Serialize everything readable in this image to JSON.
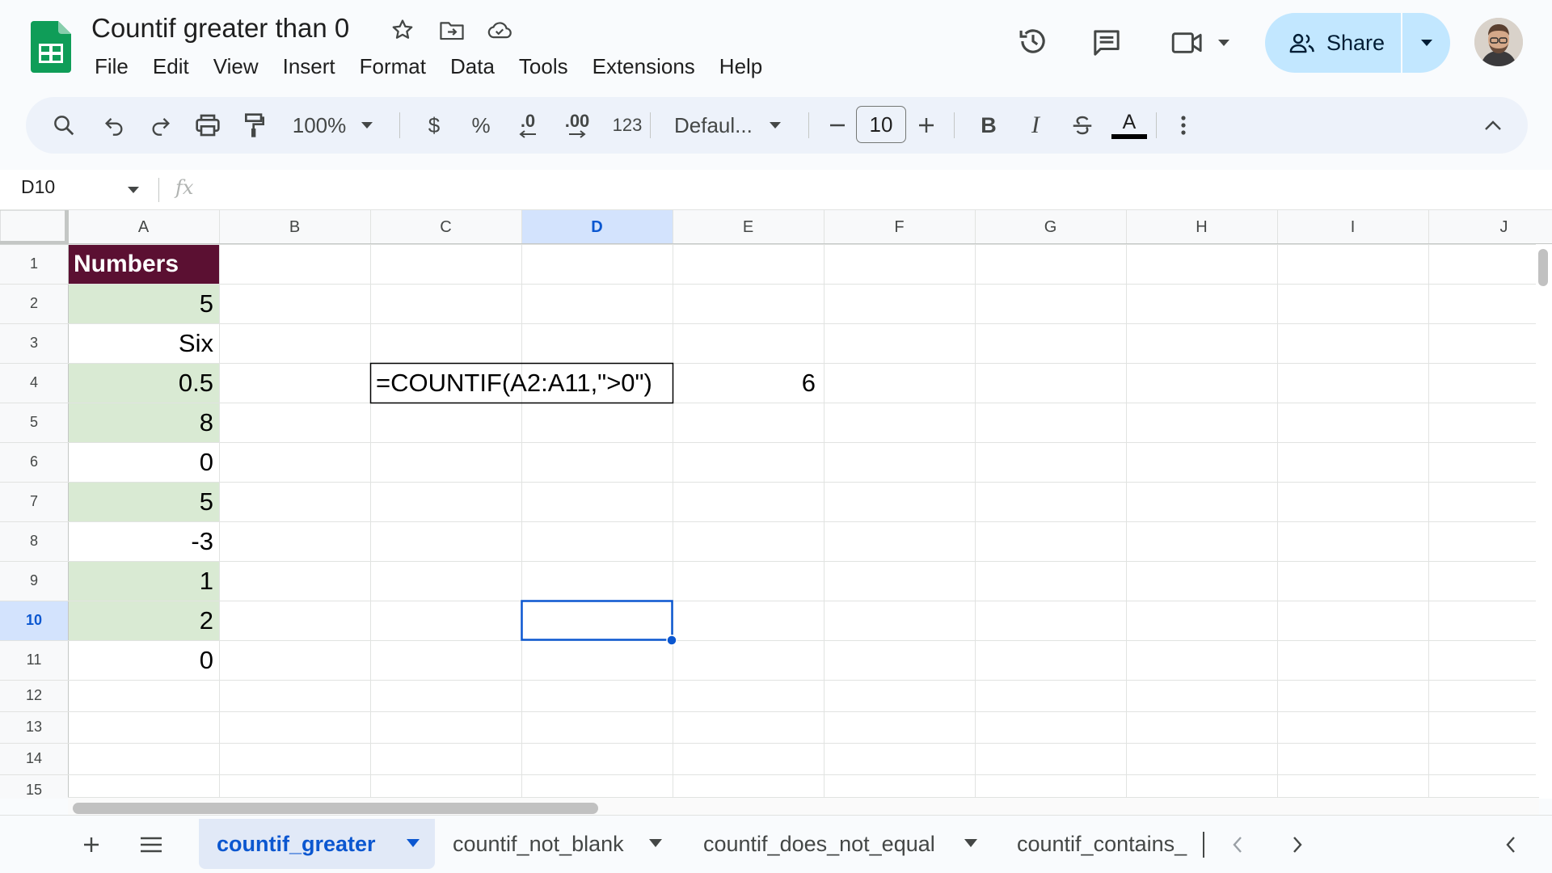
{
  "app": {
    "title": "Countif greater than 0",
    "menu": [
      "File",
      "Edit",
      "View",
      "Insert",
      "Format",
      "Data",
      "Tools",
      "Extensions",
      "Help"
    ],
    "share_label": "Share",
    "logo_icon": "google-sheets-logo",
    "colors": {
      "accent": "#0b57d0",
      "share_bg": "#c2e7ff",
      "header_fill": "#5b1032",
      "highlight_fill": "#d9ead3",
      "sheets_green": "#0f9d58"
    }
  },
  "toolbar": {
    "zoom": "100%",
    "currency": "$",
    "percent": "%",
    "decrease_decimal": ".0",
    "increase_decimal": ".00",
    "number_format": "123",
    "font": "Defaul...",
    "font_size": "10",
    "bold": "B",
    "italic": "I",
    "text_color": "A"
  },
  "formula_bar": {
    "cell_ref": "D10",
    "fx": "fx",
    "content": ""
  },
  "grid": {
    "columns": [
      "A",
      "B",
      "C",
      "D",
      "E",
      "F",
      "G",
      "H",
      "I",
      "J"
    ],
    "rows": [
      "1",
      "2",
      "3",
      "4",
      "5",
      "6",
      "7",
      "8",
      "9",
      "10",
      "11",
      "12",
      "13",
      "14",
      "15"
    ],
    "selected_cell": "D10",
    "column_a": [
      "Numbers",
      "5",
      "Six",
      "0.5",
      "8",
      "0",
      "5",
      "-3",
      "1",
      "2",
      "0"
    ],
    "formula_text": "=COUNTIF(A2:A11,\">0\")",
    "formula_result": "6"
  },
  "sheets": {
    "tabs": [
      "countif_greater",
      "countif_not_blank",
      "countif_does_not_equal",
      "countif_contains_"
    ],
    "active": "countif_greater"
  }
}
